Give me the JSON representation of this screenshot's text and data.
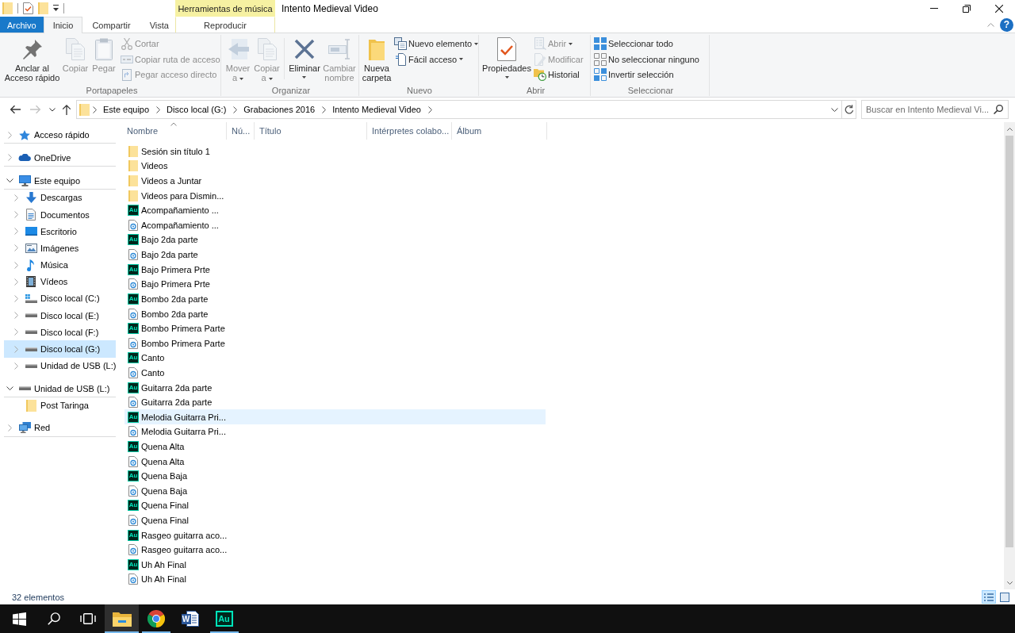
{
  "window": {
    "title": "Intento Medieval Video"
  },
  "quick_access_toolbar": [
    {
      "kind": "folder"
    },
    {
      "kind": "properties"
    },
    {
      "kind": "new-folder"
    },
    {
      "kind": "customize"
    }
  ],
  "contextual_group": {
    "label": "Herramientas de música"
  },
  "tabs": [
    {
      "label": "Archivo",
      "kind": "file",
      "selected": false
    },
    {
      "label": "Inicio",
      "kind": "standard",
      "selected": true
    },
    {
      "label": "Compartir",
      "kind": "standard",
      "selected": false
    },
    {
      "label": "Vista",
      "kind": "standard",
      "selected": false
    },
    {
      "label": "Reproducir",
      "kind": "contextual",
      "selected": false
    }
  ],
  "help_button": {
    "label": "?"
  },
  "ribbon": {
    "groups": [
      {
        "label": "Portapapeles",
        "commands": [
          {
            "label": "Anclar al\nAcceso rápido",
            "kind": "large",
            "disabled": false,
            "dropdown": false
          },
          {
            "label": "Copiar",
            "kind": "large",
            "disabled": true,
            "dropdown": false
          },
          {
            "label": "Pegar",
            "kind": "large",
            "disabled": true,
            "dropdown": false
          },
          {
            "label": "Cortar",
            "kind": "small",
            "disabled": true,
            "dropdown": false
          },
          {
            "label": "Copiar ruta de acceso",
            "kind": "small",
            "disabled": true,
            "dropdown": false
          },
          {
            "label": "Pegar acceso directo",
            "kind": "small",
            "disabled": true,
            "dropdown": false
          }
        ]
      },
      {
        "label": "Organizar",
        "commands": [
          {
            "label": "Mover\na",
            "kind": "large",
            "disabled": true,
            "dropdown": true
          },
          {
            "label": "Copiar\na",
            "kind": "large",
            "disabled": true,
            "dropdown": true
          },
          {
            "label": "Eliminar",
            "kind": "large",
            "disabled": false,
            "dropdown": true
          },
          {
            "label": "Cambiar\nnombre",
            "kind": "large",
            "disabled": true,
            "dropdown": false
          }
        ]
      },
      {
        "label": "Nuevo",
        "commands": [
          {
            "label": "Nueva\ncarpeta",
            "kind": "large",
            "disabled": false,
            "dropdown": false
          },
          {
            "label": "Nuevo elemento",
            "kind": "small",
            "disabled": false,
            "dropdown": true
          },
          {
            "label": "Fácil acceso",
            "kind": "small",
            "disabled": false,
            "dropdown": true
          }
        ]
      },
      {
        "label": "Abrir",
        "commands": [
          {
            "label": "Propiedades",
            "kind": "large",
            "disabled": false,
            "dropdown": true
          },
          {
            "label": "Abrir",
            "kind": "small",
            "disabled": true,
            "dropdown": true
          },
          {
            "label": "Modificar",
            "kind": "small",
            "disabled": true,
            "dropdown": false
          },
          {
            "label": "Historial",
            "kind": "small",
            "disabled": false,
            "dropdown": false
          }
        ]
      },
      {
        "label": "Seleccionar",
        "commands": [
          {
            "label": "Seleccionar todo",
            "kind": "small",
            "disabled": false,
            "dropdown": false
          },
          {
            "label": "No seleccionar ninguno",
            "kind": "small",
            "disabled": false,
            "dropdown": false
          },
          {
            "label": "Invertir selección",
            "kind": "small",
            "disabled": false,
            "dropdown": false
          }
        ]
      }
    ]
  },
  "navigation": {
    "buttons": [
      {
        "kind": "back",
        "disabled": false
      },
      {
        "kind": "forward",
        "disabled": true
      },
      {
        "kind": "recent",
        "disabled": false
      },
      {
        "kind": "up",
        "disabled": false
      }
    ]
  },
  "address_bar": {
    "crumbs": [
      "Este equipo",
      "Disco local (G:)",
      "Grabaciones 2016",
      "Intento Medieval Video"
    ]
  },
  "search": {
    "placeholder": "Buscar en Intento Medieval Vi..."
  },
  "nav_pane": {
    "items": [
      {
        "label": "Acceso rápido",
        "kind": "quick-access",
        "expanded": false,
        "selected": false
      },
      {
        "label": "OneDrive",
        "kind": "cloud",
        "expanded": false,
        "selected": false
      },
      {
        "label": "Este equipo",
        "kind": "computer",
        "expanded": true,
        "selected": false,
        "children": [
          {
            "label": "Descargas",
            "kind": "downloads",
            "expanded": false,
            "selected": false
          },
          {
            "label": "Documentos",
            "kind": "documents",
            "expanded": false,
            "selected": false
          },
          {
            "label": "Escritorio",
            "kind": "desktop",
            "expanded": false,
            "selected": false
          },
          {
            "label": "Imágenes",
            "kind": "pictures",
            "expanded": false,
            "selected": false
          },
          {
            "label": "Música",
            "kind": "music",
            "expanded": false,
            "selected": false
          },
          {
            "label": "Vídeos",
            "kind": "videos",
            "expanded": false,
            "selected": false
          },
          {
            "label": "Disco local (C:)",
            "kind": "system-drive",
            "expanded": false,
            "selected": false
          },
          {
            "label": "Disco local (E:)",
            "kind": "drive",
            "expanded": false,
            "selected": false
          },
          {
            "label": "Disco local (F:)",
            "kind": "drive",
            "expanded": false,
            "selected": false
          },
          {
            "label": "Disco local (G:)",
            "kind": "drive",
            "expanded": false,
            "selected": true
          },
          {
            "label": "Unidad de USB (L:)",
            "kind": "drive",
            "expanded": false,
            "selected": false
          }
        ]
      },
      {
        "label": "Unidad de USB (L:)",
        "kind": "drive",
        "expanded": true,
        "selected": false,
        "children": [
          {
            "label": "Post Taringa",
            "kind": "folder",
            "selected": false
          }
        ]
      },
      {
        "label": "Red",
        "kind": "network",
        "expanded": false,
        "selected": false
      }
    ]
  },
  "file_list": {
    "columns": [
      {
        "label": "Nombre",
        "sorted": true
      },
      {
        "label": "Nú...",
        "sorted": false
      },
      {
        "label": "Título",
        "sorted": false
      },
      {
        "label": "Intérpretes colabo...",
        "sorted": false
      },
      {
        "label": "Álbum",
        "sorted": false
      }
    ],
    "rows": [
      {
        "name": "Sesión sin título 1",
        "kind": "folder",
        "hovered": false
      },
      {
        "name": "Videos",
        "kind": "folder",
        "hovered": false
      },
      {
        "name": "Videos a Juntar",
        "kind": "folder",
        "hovered": false
      },
      {
        "name": "Videos para Dismin...",
        "kind": "folder",
        "hovered": false
      },
      {
        "name": "Acompañamiento ...",
        "kind": "session",
        "badge": "Au",
        "hovered": false
      },
      {
        "name": "Acompañamiento ...",
        "kind": "audio",
        "hovered": false
      },
      {
        "name": "Bajo 2da parte",
        "kind": "session",
        "badge": "Au",
        "hovered": false
      },
      {
        "name": "Bajo 2da parte",
        "kind": "audio",
        "hovered": false
      },
      {
        "name": "Bajo Primera Prte",
        "kind": "session",
        "badge": "Au",
        "hovered": false
      },
      {
        "name": "Bajo Primera Prte",
        "kind": "audio",
        "hovered": false
      },
      {
        "name": "Bombo 2da parte",
        "kind": "session",
        "badge": "Au",
        "hovered": false
      },
      {
        "name": "Bombo 2da parte",
        "kind": "audio",
        "hovered": false
      },
      {
        "name": "Bombo Primera Parte",
        "kind": "session",
        "badge": "Au",
        "hovered": false
      },
      {
        "name": "Bombo Primera Parte",
        "kind": "audio",
        "hovered": false
      },
      {
        "name": "Canto",
        "kind": "session",
        "badge": "Au",
        "hovered": false
      },
      {
        "name": "Canto",
        "kind": "audio",
        "hovered": false
      },
      {
        "name": "Guitarra 2da parte",
        "kind": "session",
        "badge": "Au",
        "hovered": false
      },
      {
        "name": "Guitarra 2da parte",
        "kind": "audio",
        "hovered": false
      },
      {
        "name": "Melodia Guitarra Pri...",
        "kind": "session",
        "badge": "Au",
        "hovered": true
      },
      {
        "name": "Melodia Guitarra Pri...",
        "kind": "audio",
        "hovered": false
      },
      {
        "name": "Quena Alta",
        "kind": "session",
        "badge": "Au",
        "hovered": false
      },
      {
        "name": "Quena Alta",
        "kind": "audio",
        "hovered": false
      },
      {
        "name": "Quena Baja",
        "kind": "session",
        "badge": "Au",
        "hovered": false
      },
      {
        "name": "Quena Baja",
        "kind": "audio",
        "hovered": false
      },
      {
        "name": "Quena Final",
        "kind": "session",
        "badge": "Au",
        "hovered": false
      },
      {
        "name": "Quena Final",
        "kind": "audio",
        "hovered": false
      },
      {
        "name": "Rasgeo guitarra aco...",
        "kind": "session",
        "badge": "Au",
        "hovered": false
      },
      {
        "name": "Rasgeo guitarra aco...",
        "kind": "audio",
        "hovered": false
      },
      {
        "name": "Uh Ah Final",
        "kind": "session",
        "badge": "Au",
        "hovered": false
      },
      {
        "name": "Uh Ah Final",
        "kind": "audio",
        "hovered": false
      }
    ]
  },
  "status_bar": {
    "item_count": "32 elementos",
    "views": [
      {
        "kind": "details",
        "selected": true
      },
      {
        "kind": "large-icons",
        "selected": false
      }
    ]
  },
  "taskbar": {
    "buttons": [
      {
        "kind": "start"
      },
      {
        "kind": "search"
      },
      {
        "kind": "task-view"
      }
    ],
    "apps": [
      {
        "kind": "files",
        "running": true,
        "selected": true
      },
      {
        "kind": "browser",
        "running": true,
        "selected": false
      },
      {
        "kind": "word",
        "badge": "W",
        "running": false,
        "selected": false
      },
      {
        "kind": "audition",
        "badge": "Au",
        "running": true,
        "selected": false
      }
    ]
  }
}
